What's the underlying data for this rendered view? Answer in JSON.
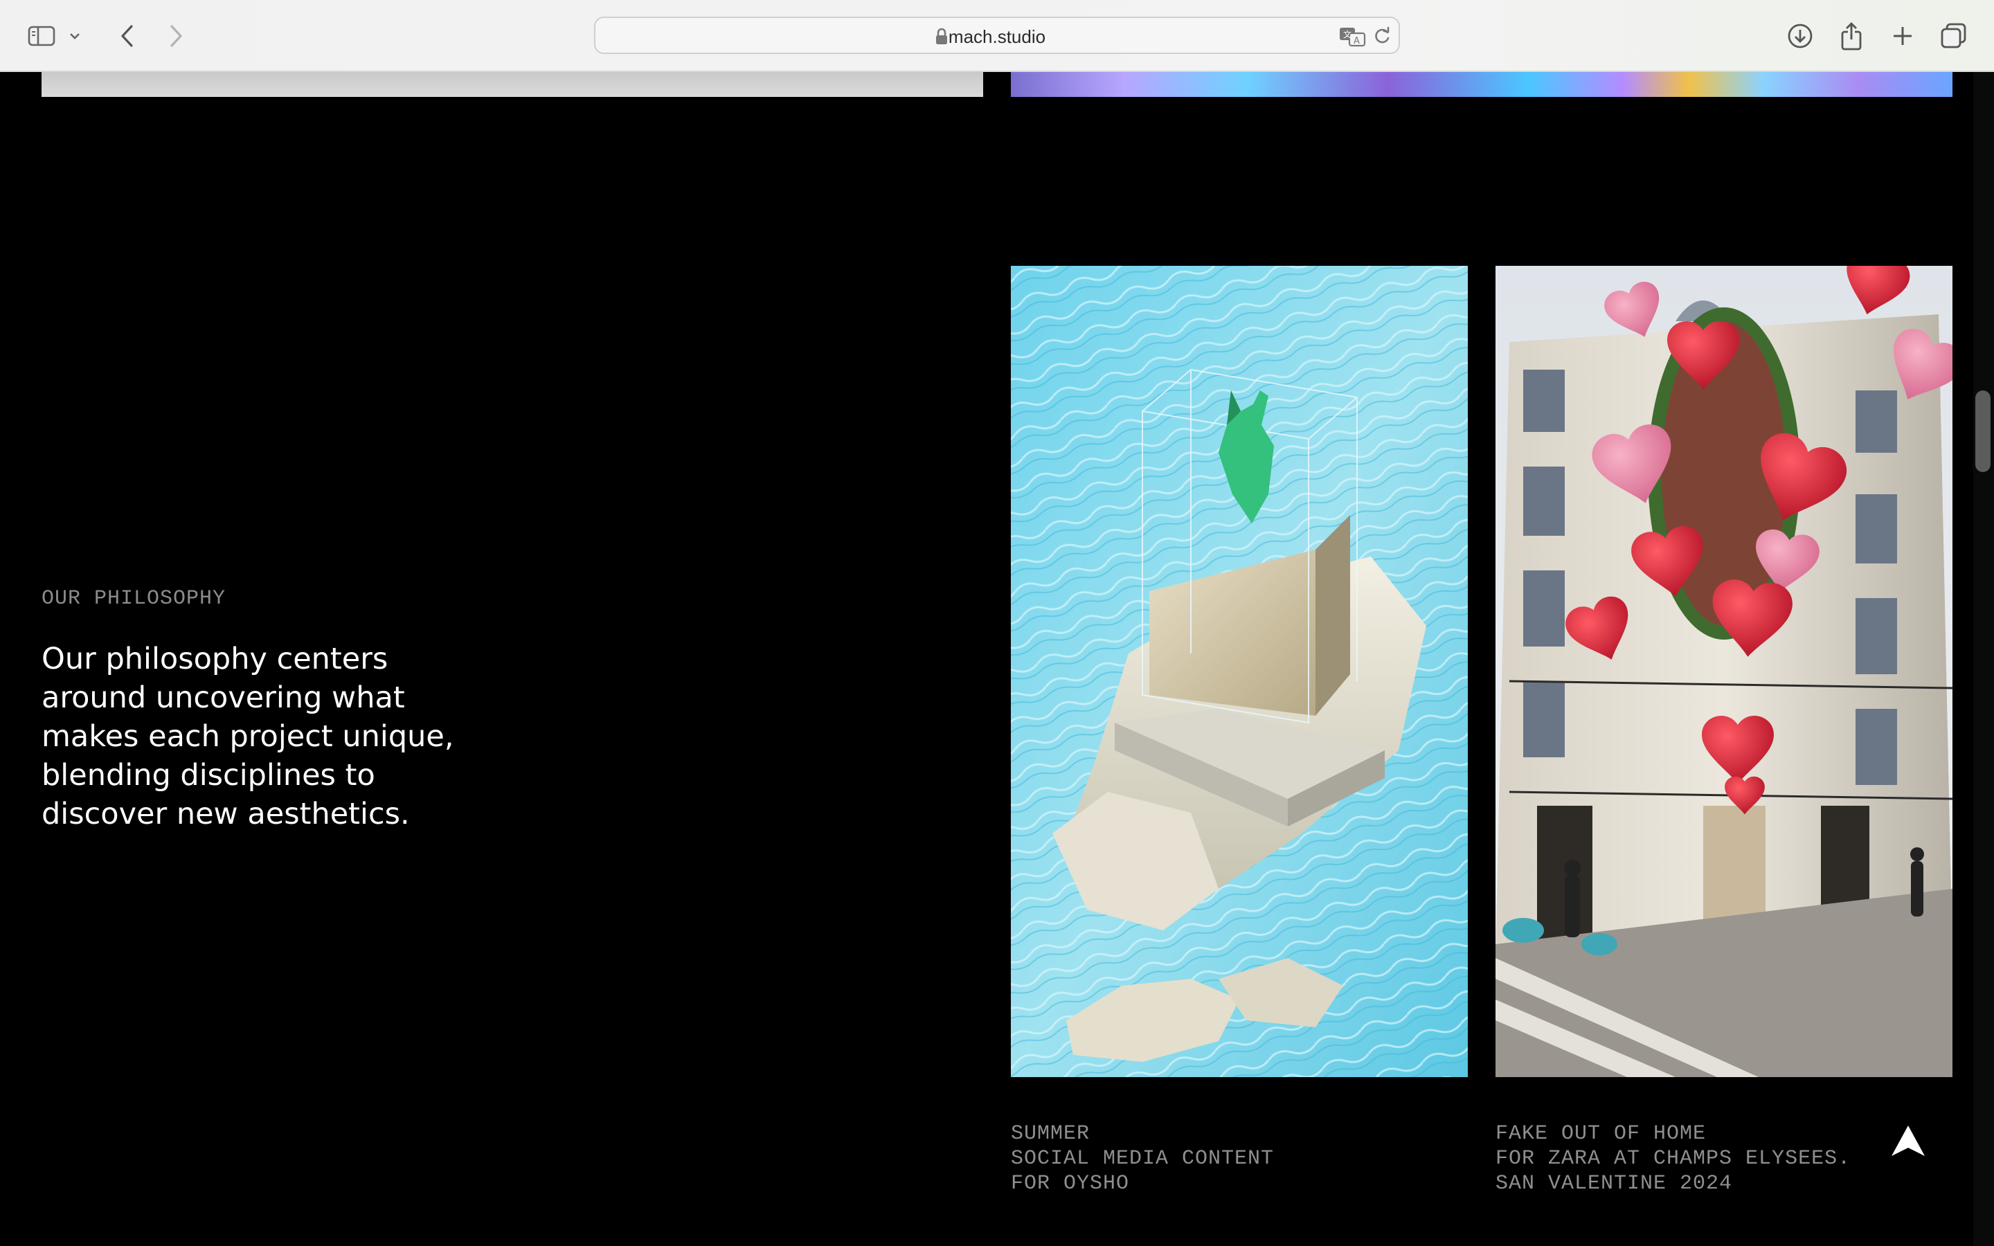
{
  "browser": {
    "url": "mach.studio",
    "icons": [
      "sidebar-icon",
      "chevron-down-icon",
      "back-icon",
      "forward-icon",
      "lock-icon",
      "translate-icon",
      "reload-icon",
      "download-icon",
      "share-icon",
      "new-tab-icon",
      "tabs-overview-icon"
    ]
  },
  "philosophy": {
    "label": "OUR PHILOSOPHY",
    "text": "Our philosophy centers around uncovering what makes each project unique, blending disciplines to discover new aesthetics."
  },
  "projects": [
    {
      "image": "swimsuit-on-rock-in-water",
      "caption": [
        "SUMMER",
        "SOCIAL MEDIA CONTENT",
        "FOR OYSHO"
      ]
    },
    {
      "image": "hearts-on-paris-building",
      "caption": [
        "FAKE OUT OF HOME",
        "FOR ZARA AT CHAMPS ELYSEES.",
        "SAN VALENTINE 2024"
      ]
    }
  ],
  "colors": {
    "background": "#000000",
    "label": "#8c8c8c",
    "body_text": "#ffffff",
    "caption": "#8f8f8f"
  }
}
